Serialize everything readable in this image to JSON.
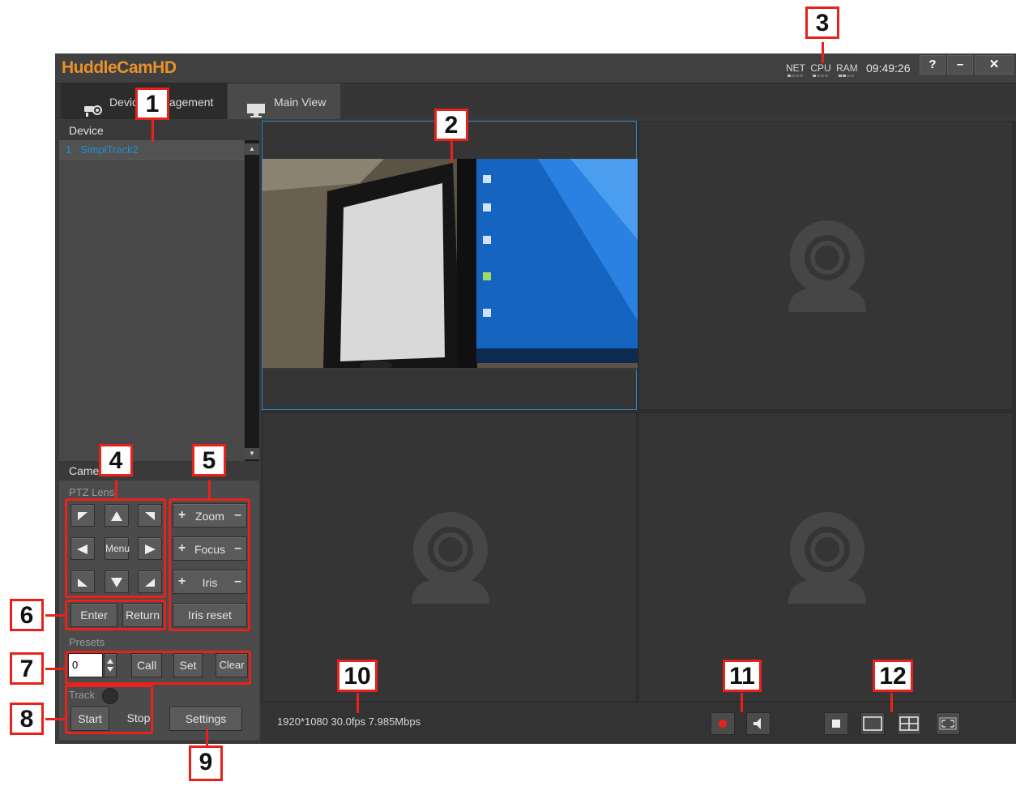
{
  "app": {
    "title": "HuddleCamHD",
    "meters": [
      "NET",
      "CPU",
      "RAM"
    ],
    "time": "09:49:26",
    "window_buttons": [
      "?",
      "–",
      "✕"
    ]
  },
  "tabs": [
    {
      "label": "Device Management",
      "icon": "camera-icon",
      "active": true
    },
    {
      "label": "Main View",
      "icon": "monitor-icon",
      "active": false
    }
  ],
  "device_panel": {
    "header": "Device",
    "items": [
      {
        "index": "1",
        "name": "SimplTrack2"
      }
    ]
  },
  "camera_panel": {
    "header": "Camera",
    "ptz_label": "PTZ Lens",
    "menu_label": "Menu",
    "lens": [
      {
        "name": "Zoom",
        "plus": "+",
        "minus": "–"
      },
      {
        "name": "Focus",
        "plus": "+",
        "minus": "–"
      },
      {
        "name": "Iris",
        "plus": "+",
        "minus": "–"
      }
    ],
    "enter_label": "Enter",
    "return_label": "Return",
    "iris_reset_label": "Iris reset",
    "presets_label": "Presets",
    "preset_value": "0",
    "call_label": "Call",
    "set_label": "Set",
    "clear_label": "Clear",
    "track_label": "Track",
    "start_label": "Start",
    "stop_label": "Stop",
    "settings_label": "Settings"
  },
  "main_view": {
    "stream_info": "1920*1080 30.0fps 7.985Mbps",
    "cells": [
      "live-video",
      "no-signal",
      "no-signal",
      "no-signal"
    ]
  },
  "callouts": [
    "1",
    "2",
    "3",
    "4",
    "5",
    "6",
    "7",
    "8",
    "9",
    "10",
    "11",
    "12"
  ],
  "colors": {
    "accent": "#e8922a",
    "selection": "#2a8ad0",
    "callout": "#e8221a",
    "device_text": "#1e8fd0"
  }
}
